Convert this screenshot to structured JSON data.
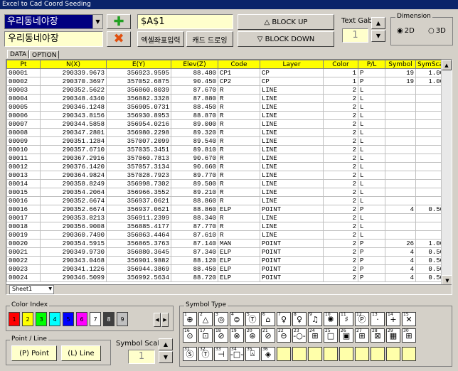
{
  "window_title": "Excel to Cad Coord Seeding",
  "combo_value": "우리동네야장",
  "name_display": "우리동네야장",
  "cell_ref": "$A$1",
  "buttons": {
    "coord_input": "엑셀좌표입력",
    "cad_draw": "캐드 드로잉",
    "block_up": "△ BLOCK UP",
    "block_down": "▽ BLOCK DOWN",
    "point": "(P) Point",
    "line": "(L) Line"
  },
  "text_gab": {
    "label": "Text Gab",
    "value": "1"
  },
  "dimension": {
    "label": "Dimension",
    "opt2d": "2D",
    "opt3d": "3D",
    "selected": "2D"
  },
  "tabs": [
    "DATA",
    "OPTION"
  ],
  "columns": [
    "Pt",
    "N(X)",
    "E(Y)",
    "Elev(Z)",
    "Code",
    "Layer",
    "Color",
    "P/L",
    "Symbol",
    "SymScale"
  ],
  "rows": [
    [
      "00001",
      "290339.9673",
      "356923.9595",
      "88.480",
      "CP1",
      "CP",
      "1",
      "P",
      "19",
      "1.00"
    ],
    [
      "00002",
      "290370.3697",
      "357052.6875",
      "90.450",
      "CP2",
      "CP",
      "1",
      "P",
      "19",
      "1.00"
    ],
    [
      "00003",
      "290352.5622",
      "356860.8039",
      "87.670",
      "R",
      "LINE",
      "2",
      "L",
      "",
      ""
    ],
    [
      "00004",
      "290348.4340",
      "356882.3328",
      "87.880",
      "R",
      "LINE",
      "2",
      "L",
      "",
      ""
    ],
    [
      "00005",
      "290346.1248",
      "356905.0731",
      "88.450",
      "R",
      "LINE",
      "2",
      "L",
      "",
      ""
    ],
    [
      "00006",
      "290343.8156",
      "356930.8953",
      "88.870",
      "R",
      "LINE",
      "2",
      "L",
      "",
      ""
    ],
    [
      "00007",
      "290344.5858",
      "356954.0216",
      "89.000",
      "R",
      "LINE",
      "2",
      "L",
      "",
      ""
    ],
    [
      "00008",
      "290347.2801",
      "356980.2298",
      "89.320",
      "R",
      "LINE",
      "2",
      "L",
      "",
      ""
    ],
    [
      "00009",
      "290351.1284",
      "357007.2099",
      "89.540",
      "R",
      "LINE",
      "2",
      "L",
      "",
      ""
    ],
    [
      "00010",
      "290357.6710",
      "357035.3451",
      "89.810",
      "R",
      "LINE",
      "2",
      "L",
      "",
      ""
    ],
    [
      "00011",
      "290367.2916",
      "357060.7813",
      "90.670",
      "R",
      "LINE",
      "2",
      "L",
      "",
      ""
    ],
    [
      "00012",
      "290376.1420",
      "357057.3134",
      "90.660",
      "R",
      "LINE",
      "2",
      "L",
      "",
      ""
    ],
    [
      "00013",
      "290364.9824",
      "357028.7923",
      "89.770",
      "R",
      "LINE",
      "2",
      "L",
      "",
      ""
    ],
    [
      "00014",
      "290358.8249",
      "356998.7302",
      "89.500",
      "R",
      "LINE",
      "2",
      "L",
      "",
      ""
    ],
    [
      "00015",
      "290354.2064",
      "356966.3552",
      "89.210",
      "R",
      "LINE",
      "2",
      "L",
      "",
      ""
    ],
    [
      "00016",
      "290352.6674",
      "356937.0621",
      "88.860",
      "R",
      "LINE",
      "2",
      "L",
      "",
      ""
    ],
    [
      "00016",
      "290352.6674",
      "356937.0621",
      "88.860",
      "ELP",
      "POINT",
      "2",
      "P",
      "4",
      "0.50"
    ],
    [
      "00017",
      "290353.8213",
      "356911.2399",
      "88.340",
      "R",
      "LINE",
      "2",
      "L",
      "",
      ""
    ],
    [
      "00018",
      "290356.9008",
      "356885.4177",
      "87.770",
      "R",
      "LINE",
      "2",
      "L",
      "",
      ""
    ],
    [
      "00019",
      "290360.7490",
      "356863.4464",
      "87.610",
      "R",
      "LINE",
      "2",
      "L",
      "",
      ""
    ],
    [
      "00020",
      "290354.5915",
      "356865.3763",
      "87.140",
      "MAN",
      "POINT",
      "2",
      "P",
      "26",
      "1.00"
    ],
    [
      "00021",
      "290349.9730",
      "356880.3645",
      "87.340",
      "ELP",
      "POINT",
      "2",
      "P",
      "4",
      "0.50"
    ],
    [
      "00022",
      "290343.0468",
      "356901.9882",
      "88.120",
      "ELP",
      "POINT",
      "2",
      "P",
      "4",
      "0.50"
    ],
    [
      "00023",
      "290341.1226",
      "356944.3869",
      "88.450",
      "ELP",
      "POINT",
      "2",
      "P",
      "4",
      "0.50"
    ],
    [
      "00024",
      "290346.5099",
      "356992.5634",
      "88.720",
      "ELP",
      "POINT",
      "2",
      "P",
      "4",
      "0.50"
    ]
  ],
  "sheet_tab": "Sheet1",
  "color_index": {
    "label": "Color Index",
    "swatches": [
      {
        "n": "1",
        "c": "#ff0000"
      },
      {
        "n": "2",
        "c": "#ffff00"
      },
      {
        "n": "3",
        "c": "#00ff00"
      },
      {
        "n": "4",
        "c": "#00ffff"
      },
      {
        "n": "5",
        "c": "#0000ff"
      },
      {
        "n": "6",
        "c": "#ff00ff"
      },
      {
        "n": "7",
        "c": "#ffffff"
      },
      {
        "n": "8",
        "c": "#404040"
      },
      {
        "n": "9",
        "c": "#c0c0c0"
      }
    ]
  },
  "point_line": {
    "label": "Point / Line"
  },
  "symbol_scale": {
    "label": "Symbol Scale",
    "value": "1"
  },
  "symbol_type": {
    "label": "Symbol Type",
    "row1": [
      {
        "n": "1",
        "g": "⊕"
      },
      {
        "n": "2",
        "g": "△"
      },
      {
        "n": "3",
        "g": "◎"
      },
      {
        "n": "4",
        "g": "⊜"
      },
      {
        "n": "5",
        "g": "Ⓣ"
      },
      {
        "n": "6",
        "g": "⌂"
      },
      {
        "n": "7",
        "g": "♀"
      },
      {
        "n": "8",
        "g": "♀"
      },
      {
        "n": "9",
        "g": "♫"
      },
      {
        "n": "10",
        "g": "✺"
      },
      {
        "n": "11",
        "g": "♯"
      },
      {
        "n": "12",
        "g": "Ⓟ"
      },
      {
        "n": "13",
        "g": "·"
      },
      {
        "n": "14",
        "g": "+"
      },
      {
        "n": "15",
        "g": "✕"
      }
    ],
    "row2": [
      {
        "n": "16",
        "g": "⊙"
      },
      {
        "n": "17",
        "g": "⊡"
      },
      {
        "n": "18",
        "g": "⊘"
      },
      {
        "n": "19",
        "g": "⊗"
      },
      {
        "n": "20",
        "g": "⊛"
      },
      {
        "n": "21",
        "g": "⊘"
      },
      {
        "n": "22",
        "g": "⊖"
      },
      {
        "n": "23",
        "g": "-○-"
      },
      {
        "n": "24",
        "g": "⊞"
      },
      {
        "n": "25",
        "g": "□"
      },
      {
        "n": "26",
        "g": "▣"
      },
      {
        "n": "27",
        "g": "⊞"
      },
      {
        "n": "28",
        "g": "⊠"
      },
      {
        "n": "29",
        "g": "▦"
      },
      {
        "n": "30",
        "g": "⊞"
      }
    ],
    "row3": [
      {
        "n": "31",
        "g": "Ⓢ"
      },
      {
        "n": "32",
        "g": "Ⓣ"
      },
      {
        "n": "33",
        "g": "⊣"
      },
      {
        "n": "34",
        "g": "-□-"
      },
      {
        "n": "35",
        "g": "⍓"
      },
      {
        "n": "36",
        "g": "◈"
      }
    ]
  }
}
